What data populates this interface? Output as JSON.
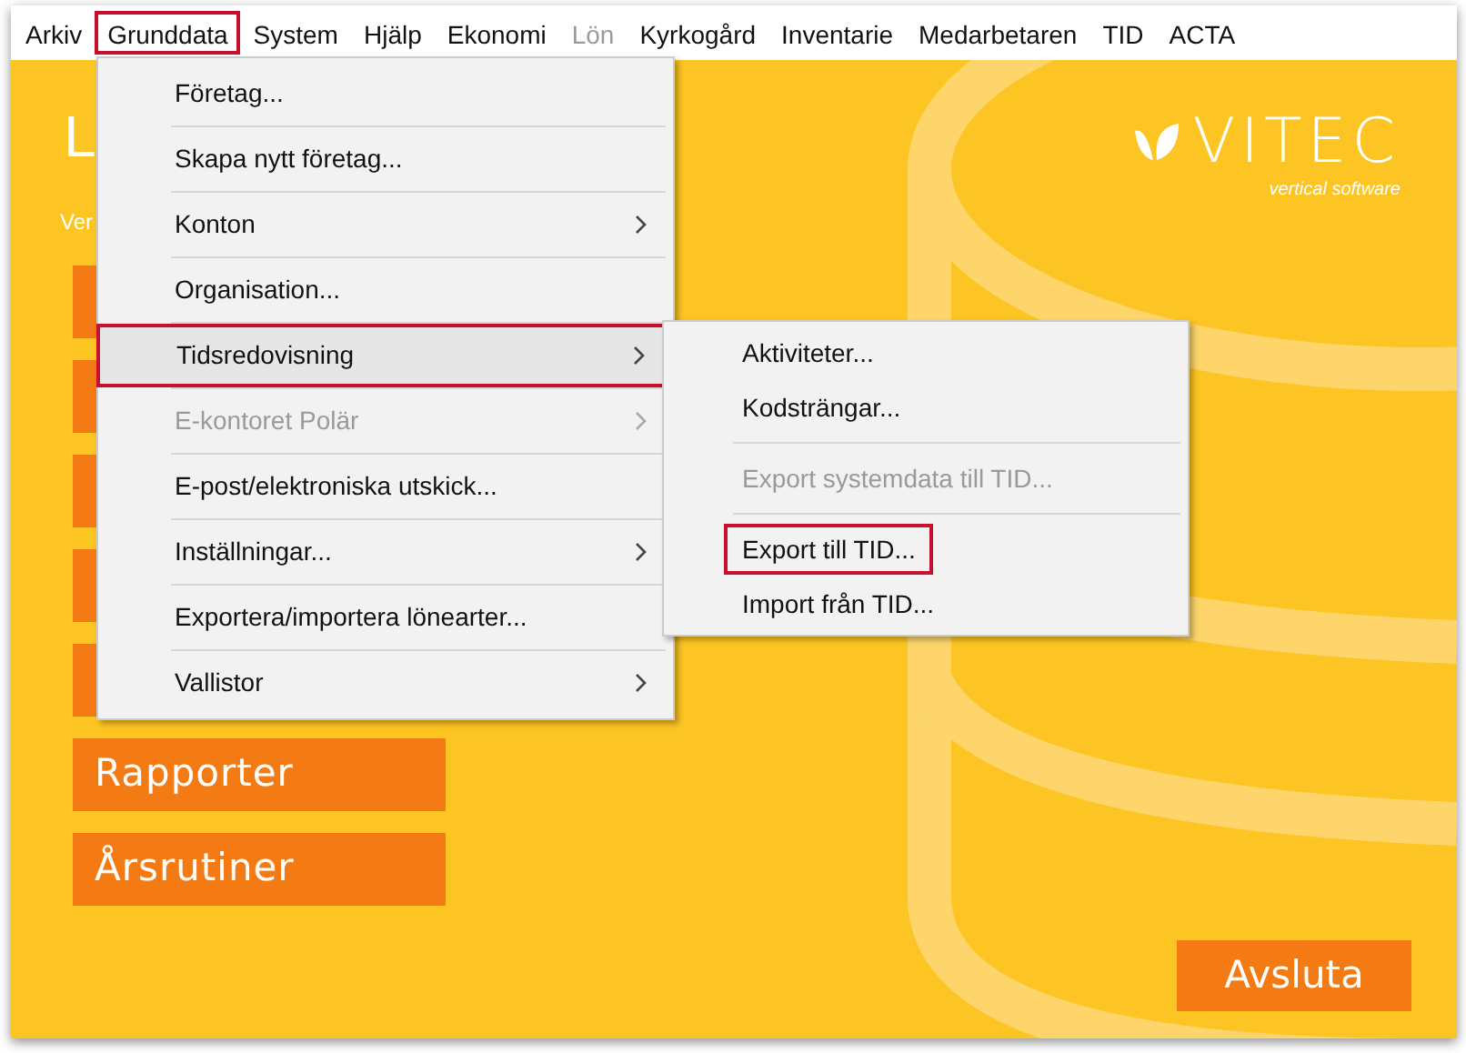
{
  "menu_bar": [
    {
      "label": "Arkiv",
      "selected": false,
      "disabled": false
    },
    {
      "label": "Grunddata",
      "selected": true,
      "disabled": false
    },
    {
      "label": "System",
      "selected": false,
      "disabled": false
    },
    {
      "label": "Hjälp",
      "selected": false,
      "disabled": false
    },
    {
      "label": "Ekonomi",
      "selected": false,
      "disabled": false
    },
    {
      "label": "Lön",
      "selected": false,
      "disabled": true
    },
    {
      "label": "Kyrkogård",
      "selected": false,
      "disabled": false
    },
    {
      "label": "Inventarie",
      "selected": false,
      "disabled": false
    },
    {
      "label": "Medarbetaren",
      "selected": false,
      "disabled": false
    },
    {
      "label": "TID",
      "selected": false,
      "disabled": false
    },
    {
      "label": "ACTA",
      "selected": false,
      "disabled": false
    }
  ],
  "app_title": "L",
  "version_label": "Ver",
  "logo": {
    "name": "VITEC",
    "tagline": "vertical software"
  },
  "side_buttons": [
    {
      "kind": "covered"
    },
    {
      "kind": "covered"
    },
    {
      "kind": "covered"
    },
    {
      "kind": "covered"
    },
    {
      "kind": "covered"
    },
    {
      "kind": "button",
      "label": "Rapporter"
    },
    {
      "kind": "button",
      "label": "Årsrutiner"
    }
  ],
  "exit_button": "Avsluta",
  "dropdown": [
    {
      "label": "Företag...",
      "submenu": false,
      "disabled": false,
      "selected": false
    },
    {
      "label": "Skapa nytt företag...",
      "submenu": false,
      "disabled": false,
      "selected": false
    },
    {
      "label": "Konton",
      "submenu": true,
      "disabled": false,
      "selected": false
    },
    {
      "label": "Organisation...",
      "submenu": false,
      "disabled": false,
      "selected": false
    },
    {
      "label": "Tidsredovisning",
      "submenu": true,
      "disabled": false,
      "selected": true
    },
    {
      "label": "E-kontoret Polär",
      "submenu": true,
      "disabled": true,
      "selected": false
    },
    {
      "label": "E-post/elektroniska utskick...",
      "submenu": false,
      "disabled": false,
      "selected": false
    },
    {
      "label": "Inställningar...",
      "submenu": true,
      "disabled": false,
      "selected": false
    },
    {
      "label": "Exportera/importera lönearter...",
      "submenu": false,
      "disabled": false,
      "selected": false
    },
    {
      "label": "Vallistor",
      "submenu": true,
      "disabled": false,
      "selected": false
    }
  ],
  "submenu": [
    {
      "kind": "item",
      "label": "Aktiviteter...",
      "disabled": false,
      "selected": false
    },
    {
      "kind": "item",
      "label": "Kodsträngar...",
      "disabled": false,
      "selected": false
    },
    {
      "kind": "separator"
    },
    {
      "kind": "item",
      "label": "Export systemdata till TID...",
      "disabled": true,
      "selected": false
    },
    {
      "kind": "separator"
    },
    {
      "kind": "item",
      "label": "Export till TID...",
      "disabled": false,
      "selected": true
    },
    {
      "kind": "item",
      "label": "Import från TID...",
      "disabled": false,
      "selected": false
    }
  ]
}
